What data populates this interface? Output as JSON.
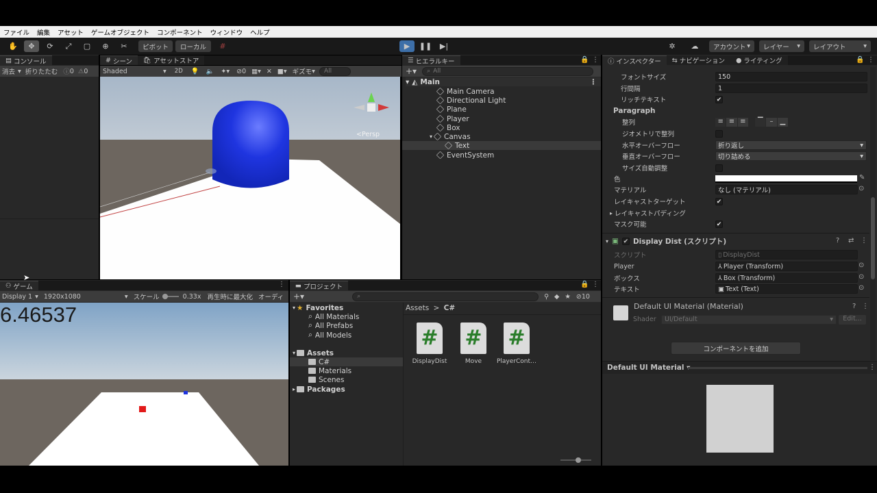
{
  "menu": [
    "ファイル",
    "編集",
    "アセット",
    "ゲームオブジェクト",
    "コンポーネント",
    "ウィンドウ",
    "ヘルプ"
  ],
  "toolbar": {
    "pivot": "ピボット",
    "local": "ローカル",
    "account": "アカウント",
    "layers": "レイヤー",
    "layout": "レイアウト"
  },
  "console": {
    "tab": "コンソール",
    "clear": "消去",
    "collapse": "折りたたむ",
    "warn_count": "0",
    "err_count": "0"
  },
  "scene": {
    "tab": "シーン",
    "asset_store_tab": "アセットストア",
    "shading": "Shaded",
    "mode2d": "2D",
    "gizmos": "ギズモ",
    "search_placeholder": "All",
    "persp": "Persp",
    "hidden_count": "0"
  },
  "hierarchy": {
    "tab": "ヒエラルキー",
    "search_placeholder": "All",
    "scene": "Main",
    "items": [
      "Main Camera",
      "Directional Light",
      "Plane",
      "Player",
      "Box",
      "Canvas",
      "Text",
      "EventSystem"
    ]
  },
  "inspector": {
    "tab": "インスペクター",
    "nav_tab": "ナビゲーション",
    "light_tab": "ライティング",
    "rows": [
      {
        "label": "フォントサイズ",
        "value": "150"
      },
      {
        "label": "行間隔",
        "value": "1"
      },
      {
        "label": "リッチテキスト",
        "value": "✔"
      }
    ],
    "paragraph": "Paragraph",
    "para_rows": [
      {
        "label": "整列"
      },
      {
        "label": "ジオメトリで整列"
      },
      {
        "label": "水平オーバーフロー",
        "value": "折り返し"
      },
      {
        "label": "垂直オーバーフロー",
        "value": "切り詰める"
      },
      {
        "label": "サイズ自動調整"
      }
    ],
    "color_label": "色",
    "material_label": "マテリアル",
    "material_value": "なし (マテリアル)",
    "raycast_label": "レイキャストターゲット",
    "raycast_padding": "レイキャストパディング",
    "maskable": "マスク可能",
    "component_title": "Display Dist (スクリプト)",
    "script_label": "スクリプト",
    "script_value": "DisplayDist",
    "player_label": "Player",
    "player_value": "Player (Transform)",
    "box_label": "ボックス",
    "box_value": "Box (Transform)",
    "text_label": "テキスト",
    "text_value": "Text (Text)",
    "material_title": "Default UI Material (Material)",
    "shader_label": "Shader",
    "shader_value": "UI/Default",
    "edit": "Edit...",
    "add_component": "コンポーネントを追加",
    "preview_title": "Default UI Material"
  },
  "game": {
    "tab": "ゲーム",
    "display": "Display 1",
    "resolution": "1920x1080",
    "scale_label": "スケール",
    "scale_value": "0.33x",
    "maximize": "再生時に最大化",
    "audio": "オーディ",
    "distance": "6.46537"
  },
  "project": {
    "tab": "プロジェクト",
    "hidden_count": "10",
    "breadcrumb_root": "Assets",
    "breadcrumb_leaf": "C#",
    "favorites": "Favorites",
    "fav_items": [
      "All Materials",
      "All Prefabs",
      "All Models"
    ],
    "assets": "Assets",
    "asset_folders": [
      "C#",
      "Materials",
      "Scenes"
    ],
    "packages": "Packages",
    "files": [
      "DisplayDist",
      "Move",
      "PlayerCont…"
    ]
  }
}
